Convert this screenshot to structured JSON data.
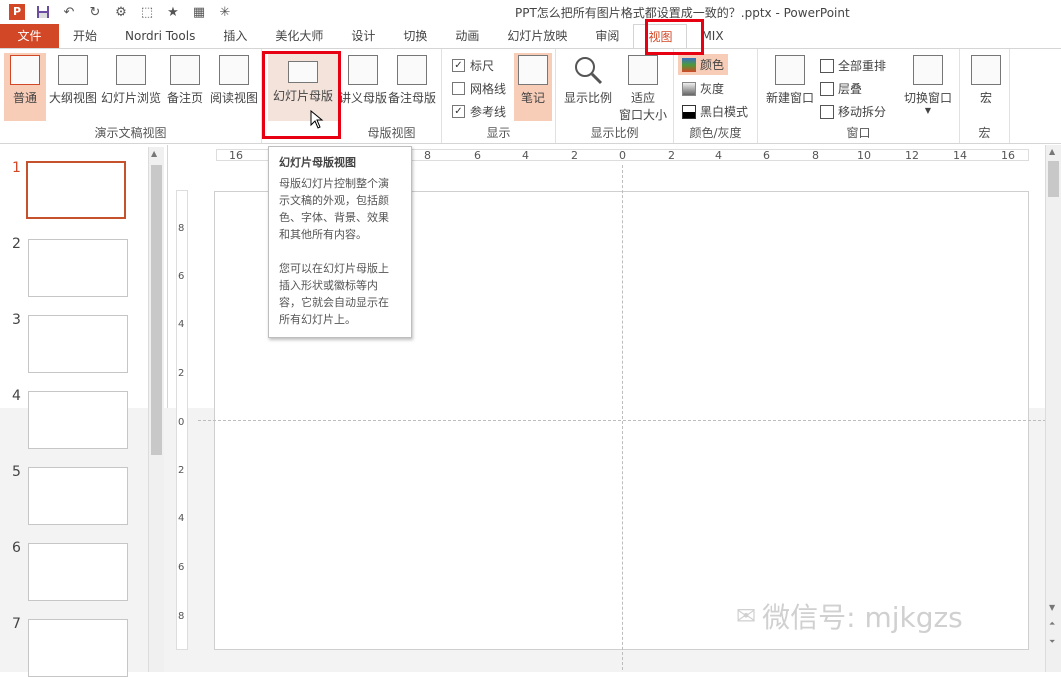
{
  "window": {
    "title": "PPT怎么把所有图片格式都设置成一致的？.pptx - PowerPoint"
  },
  "tabs": [
    "文件",
    "开始",
    "Nordri Tools",
    "插入",
    "美化大师",
    "设计",
    "切换",
    "动画",
    "幻灯片放映",
    "审阅",
    "视图",
    "MIX"
  ],
  "ribbon": {
    "presentation_views": {
      "group": "演示文稿视图",
      "normal": "普通",
      "outline": "大纲视图",
      "sorter": "幻灯片浏览",
      "notes": "备注页",
      "reading": "阅读视图"
    },
    "master_views": {
      "group": "母版视图",
      "slide_master": "幻灯片母版",
      "handout_master": "讲义母版",
      "notes_master": "备注母版"
    },
    "show": {
      "group": "显示",
      "ruler": "标尺",
      "gridlines": "网格线",
      "guides": "参考线",
      "notes": "笔记"
    },
    "zoom": {
      "group": "显示比例",
      "zoom": "显示比例",
      "fit": "适应",
      "fit2": "窗口大小"
    },
    "color": {
      "group": "颜色/灰度",
      "color": "颜色",
      "grayscale": "灰度",
      "bw": "黑白模式"
    },
    "window": {
      "group": "窗口",
      "new_window": "新建窗口",
      "arrange_all": "全部重排",
      "cascade": "层叠",
      "move_split": "移动拆分",
      "switch": "切换窗口"
    },
    "macros": {
      "group": "宏",
      "macros": "宏"
    }
  },
  "tooltip": {
    "title": "幻灯片母版视图",
    "line1": "母版幻灯片控制整个演",
    "line2": "示文稿的外观，包括颜",
    "line3": "色、字体、背景、效果",
    "line4": "和其他所有内容。",
    "line5": "您可以在幻灯片母版上",
    "line6": "插入形状或徽标等内",
    "line7": "容，它就会自动显示在",
    "line8": "所有幻灯片上。"
  },
  "thumbnails": [
    "1",
    "2",
    "3",
    "4",
    "5",
    "6",
    "7"
  ],
  "hruler": [
    "16",
    "8",
    "6",
    "4",
    "2",
    "0",
    "2",
    "4",
    "6",
    "8",
    "10",
    "12",
    "14",
    "16"
  ],
  "vruler": [
    "8",
    "6",
    "4",
    "2",
    "0",
    "2",
    "4",
    "6",
    "8"
  ],
  "watermark": "微信号: mjkgzs",
  "colors": {
    "accent": "#d24726",
    "highlight": "#f7cdb8",
    "annotation": "#e60012"
  }
}
